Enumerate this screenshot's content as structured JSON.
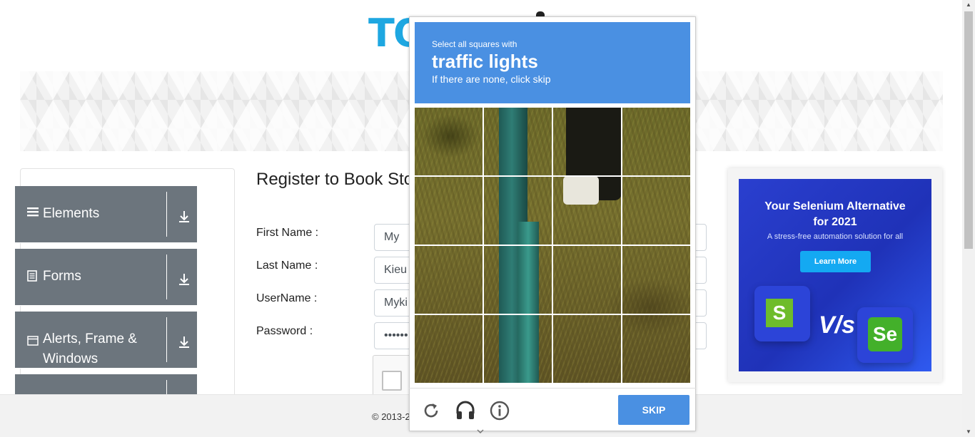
{
  "header": {
    "logo_text": "TO"
  },
  "sidebar": {
    "groups": [
      {
        "icon": "hamburger-icon",
        "label": "Elements"
      },
      {
        "icon": "document-icon",
        "label": "Forms"
      },
      {
        "icon": "window-icon",
        "label": "Alerts, Frame &",
        "label2": "Windows"
      }
    ]
  },
  "form": {
    "title": "Register to Book Sto",
    "first_name_label": "First Name :",
    "first_name_value": "My",
    "last_name_label": "Last Name :",
    "last_name_value": "Kieu",
    "username_label": "UserName :",
    "username_value": "Myki",
    "password_label": "Password :",
    "password_value": "••••••"
  },
  "ad": {
    "title_line1": "Your Selenium Alternative",
    "title_line2": "for 2021",
    "subtitle": "A stress-free automation solution for all",
    "button": "Learn More",
    "vs_text": "V/s",
    "left_logo": "S",
    "right_logo": "Se"
  },
  "footer": {
    "text": "© 2013-2"
  },
  "captcha": {
    "instruction": "Select all squares with",
    "target": "traffic lights",
    "skip_hint": "If there are none, click skip",
    "skip_button": "SKIP",
    "accent": "#4a90e2"
  },
  "colors": {
    "sidebar_group": "#6c757d",
    "logo": "#1ea7e1"
  }
}
